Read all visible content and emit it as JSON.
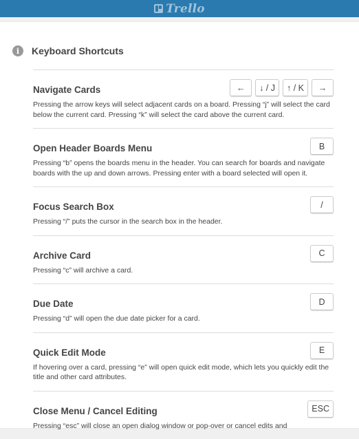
{
  "app": {
    "logo_text": "Trello"
  },
  "dialog": {
    "title": "Keyboard Shortcuts"
  },
  "shortcuts": [
    {
      "title": "Navigate Cards",
      "keys": [
        "←",
        "↓ / J",
        "↑ / K",
        "→"
      ],
      "description": "Pressing the arrow keys will select adjacent cards on a board. Pressing “j” will select the card below the current card. Pressing “k” will select the card above the current card."
    },
    {
      "title": "Open Header Boards Menu",
      "keys": [
        "B"
      ],
      "description": "Pressing “b” opens the boards menu in the header. You can search for boards and navigate boards with the up and down arrows. Pressing enter with a board selected will open it."
    },
    {
      "title": "Focus Search Box",
      "keys": [
        "/"
      ],
      "description": "Pressing “/” puts the cursor in the search box in the header."
    },
    {
      "title": "Archive Card",
      "keys": [
        "C"
      ],
      "description": "Pressing “c” will archive a card."
    },
    {
      "title": "Due Date",
      "keys": [
        "D"
      ],
      "description": "Pressing “d” will open the due date picker for a card."
    },
    {
      "title": "Quick Edit Mode",
      "keys": [
        "E"
      ],
      "description": "If hovering over a card, pressing “e” will open quick edit mode, which lets you quickly edit the title and other card attributes."
    },
    {
      "title": "Close Menu / Cancel Editing",
      "keys": [
        "ESC"
      ],
      "description": "Pressing “esc” will close an open dialog window or pop-over or cancel edits and"
    }
  ],
  "colors": {
    "header_bar": "#2a7ab0",
    "background": "#f0f0f0",
    "panel": "#ffffff"
  }
}
